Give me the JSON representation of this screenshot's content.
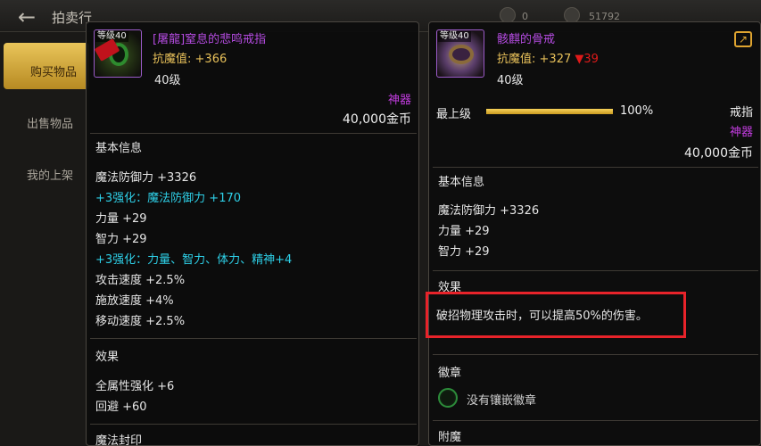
{
  "topbar": {
    "title": "拍卖行",
    "back_icon": "back-arrow-icon",
    "right_text_1": "0",
    "right_text_2": "51792"
  },
  "sidebar": {
    "tabs": [
      {
        "label": "购买物品",
        "active": true
      },
      {
        "label": "出售物品",
        "active": false
      },
      {
        "label": "我的上架",
        "active": false
      }
    ]
  },
  "left_item": {
    "icon": "ring-icon",
    "level_badge": "等级40",
    "seal_badge": "已封装",
    "name": "[屠龍]窒息的悲鸣戒指",
    "stat_label": "抗魔值:",
    "stat_value": "+366",
    "level": "40级",
    "rarity": "神器",
    "price": "40,000金币",
    "basic_info_title": "基本信息",
    "basic_info": [
      {
        "text": "魔法防御力 +3326",
        "color": "white"
      },
      {
        "text": "+3强化：魔法防御力 +170",
        "color": "cyan"
      },
      {
        "text": "力量 +29",
        "color": "white"
      },
      {
        "text": "智力 +29",
        "color": "white"
      },
      {
        "text": "+3强化：力量、智力、体力、精神+4",
        "color": "cyan"
      },
      {
        "text": "攻击速度 +2.5%",
        "color": "white"
      },
      {
        "text": "施放速度 +4%",
        "color": "white"
      },
      {
        "text": "移动速度 +2.5%",
        "color": "white"
      }
    ],
    "effect_title": "效果",
    "effects": [
      "全属性强化 +6",
      "回避 +60"
    ],
    "next_section": "魔法封印"
  },
  "right_item": {
    "icon": "ring-icon",
    "level_badge": "等级40",
    "name": "骸麒的骨戒",
    "stat_label": "抗魔值:",
    "stat_value": "+327",
    "stat_change": "▼39",
    "level": "40级",
    "upgrade_label": "最上级",
    "upgrade_fraction": 1.0,
    "upgrade_pct": "100%",
    "slot_type": "戒指",
    "rarity": "神器",
    "price": "40,000金币",
    "basic_info_title": "基本信息",
    "basic_info": [
      "魔法防御力 +3326",
      "力量 +29",
      "智力 +29"
    ],
    "effect_title": "效果",
    "effect_text": "破招物理攻击时，可以提高50%的伤害。",
    "emblem_title": "徽章",
    "emblem_text": "没有镶嵌徽章",
    "next_section": "附魔"
  },
  "colors": {
    "item_name": "#b44be0",
    "stat_gold": "#e8c15a",
    "enhance_cyan": "#2ed0e8",
    "decrease_red": "#e01a1a",
    "highlight_red": "#e8232a",
    "tab_gold": "#e9c55a"
  }
}
